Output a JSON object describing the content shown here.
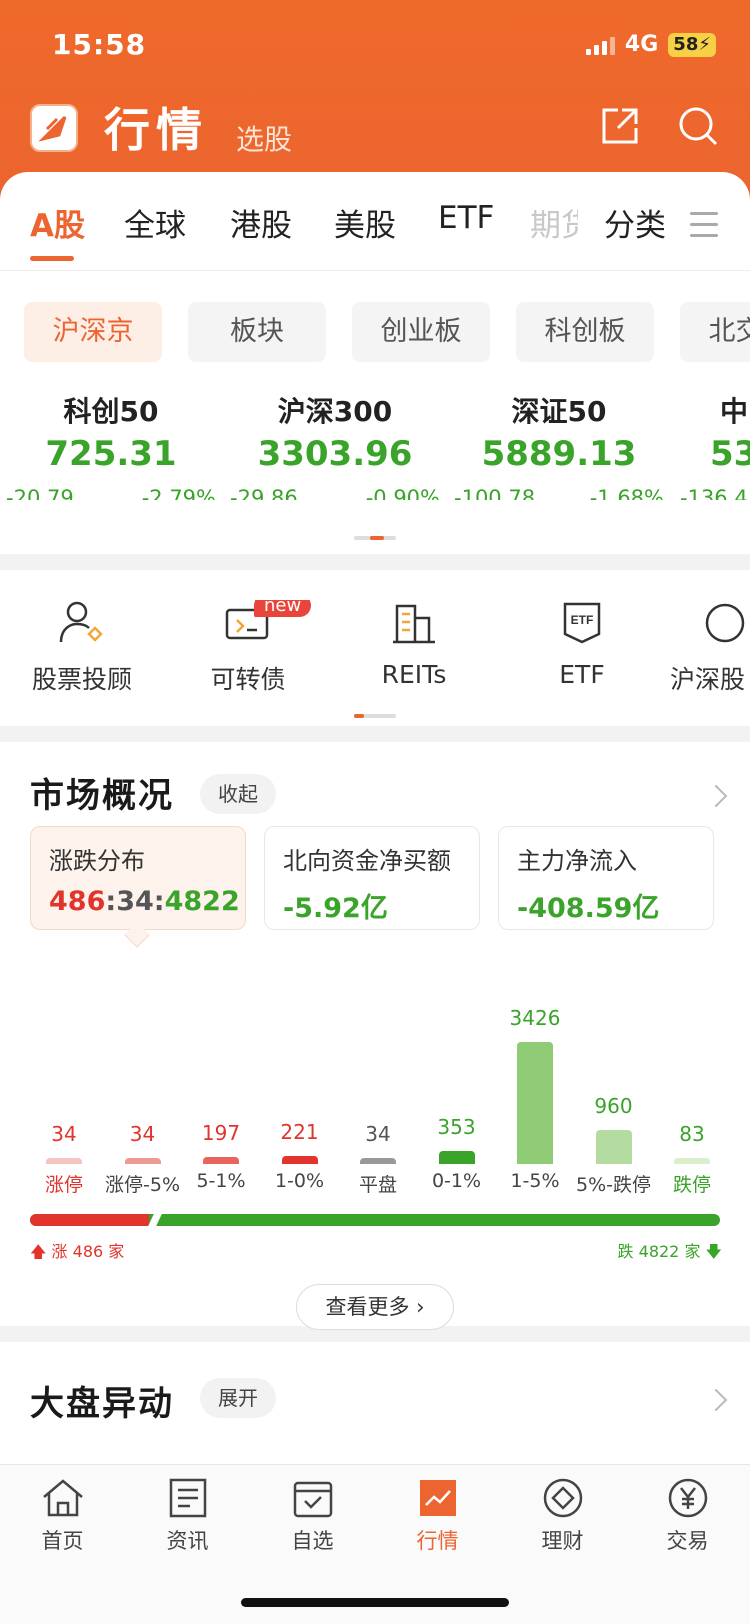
{
  "status": {
    "time": "15:58",
    "network": "4G",
    "battery": "58"
  },
  "header": {
    "title": "行情",
    "subtitle": "选股"
  },
  "tabs": {
    "items": [
      "A股",
      "全球",
      "港股",
      "美股",
      "ETF"
    ],
    "overflow": "期货",
    "category": "分类"
  },
  "chips": [
    "沪深京",
    "板块",
    "创业板",
    "科创板",
    "北交所"
  ],
  "indices": [
    {
      "name": "科创50",
      "value": "725.31",
      "change": "-20.79",
      "pct": "-2.79%"
    },
    {
      "name": "沪深300",
      "value": "3303.96",
      "change": "-29.86",
      "pct": "-0.90%"
    },
    {
      "name": "深证50",
      "value": "5889.13",
      "change": "-100.78",
      "pct": "-1.68%"
    },
    {
      "name": "中",
      "value": "53",
      "change": "-136.4",
      "pct": ""
    }
  ],
  "quick": {
    "items": [
      "股票投顾",
      "可转债",
      "REITs",
      "ETF",
      "沪深股"
    ],
    "new_badge": "new"
  },
  "market": {
    "title": "市场概况",
    "collapse": "收起",
    "stats": [
      {
        "label": "涨跌分布",
        "up": "486",
        "flat": "34",
        "down": "4822"
      },
      {
        "label": "北向资金净买额",
        "value": "-5.92亿"
      },
      {
        "label": "主力净流入",
        "value": "-408.59亿"
      }
    ],
    "distribution": [
      {
        "label": "涨停",
        "count": "34",
        "value": 34,
        "color": "#f5c3c0",
        "text": "#e0342c"
      },
      {
        "label": "涨停-5%",
        "count": "34",
        "value": 34,
        "color": "#ee9a94",
        "text": "#e0342c"
      },
      {
        "label": "5-1%",
        "count": "197",
        "value": 197,
        "color": "#e8645c",
        "text": "#e0342c"
      },
      {
        "label": "1-0%",
        "count": "221",
        "value": 221,
        "color": "#e0342c",
        "text": "#e0342c"
      },
      {
        "label": "平盘",
        "count": "34",
        "value": 34,
        "color": "#999999",
        "text": "#555555"
      },
      {
        "label": "0-1%",
        "count": "353",
        "value": 353,
        "color": "#3aa32a",
        "text": "#3aa32a"
      },
      {
        "label": "1-5%",
        "count": "3426",
        "value": 3426,
        "color": "#8fcb74",
        "text": "#3aa32a"
      },
      {
        "label": "5%-跌停",
        "count": "960",
        "value": 960,
        "color": "#b4dca0",
        "text": "#3aa32a"
      },
      {
        "label": "跌停",
        "count": "83",
        "value": 83,
        "color": "#d9efcc",
        "text": "#3aa32a"
      }
    ],
    "up_label": "涨 486 家",
    "down_label": "跌 4822 家",
    "up_total": 486,
    "down_total": 4822,
    "more": "查看更多"
  },
  "movers": {
    "title": "大盘异动",
    "expand": "展开"
  },
  "nav": [
    "首页",
    "资讯",
    "自选",
    "行情",
    "理财",
    "交易"
  ],
  "colors": {
    "accent": "#ec6430",
    "up": "#e0342c",
    "down": "#3aa32a"
  }
}
